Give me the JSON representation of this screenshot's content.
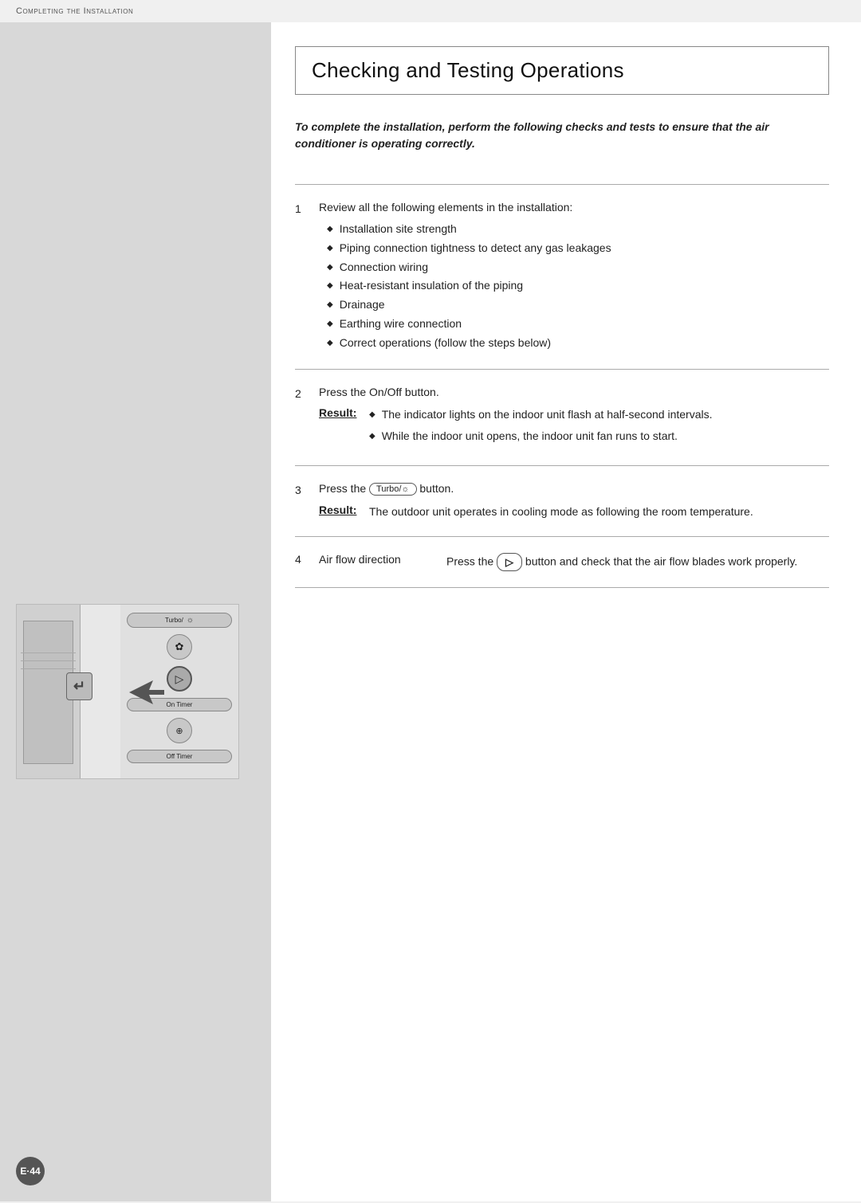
{
  "header": {
    "breadcrumb": "Completing the Installation"
  },
  "page": {
    "title": "Checking and Testing Operations",
    "intro": "To complete the installation, perform the following checks and tests to ensure that the air conditioner is operating correctly.",
    "steps": [
      {
        "number": "1",
        "title": "Review all the following elements in the installation:",
        "bullets": [
          "Installation site strength",
          "Piping connection tightness to detect any gas leakages",
          "Connection wiring",
          "Heat-resistant insulation of the piping",
          "Drainage",
          "Earthing wire connection",
          "Correct operations (follow the steps below)"
        ]
      },
      {
        "number": "2",
        "title": "Press the On/Off button.",
        "result_label": "Result:",
        "result_bullets": [
          "The indicator lights on the indoor unit flash at half-second intervals.",
          "While the indoor unit opens, the indoor unit fan runs to start."
        ]
      },
      {
        "number": "3",
        "title_prefix": "Press the",
        "title_btn": "Turbo/",
        "title_suffix": "button.",
        "result_label": "Result:",
        "result_text": "The outdoor unit operates in cooling mode as following the room temperature."
      },
      {
        "number": "4",
        "label": "Air flow direction",
        "text_prefix": "Press the",
        "btn_label": "▷",
        "text_suffix": "button and check that the air flow blades work properly."
      }
    ],
    "page_number": "E·44"
  },
  "device": {
    "vane_symbol": "↵",
    "buttons": [
      {
        "label": "Turbo/☼",
        "highlighted": false
      },
      {
        "label": "✿",
        "highlighted": false,
        "round": true
      },
      {
        "label": "▷",
        "highlighted": true,
        "round": true
      },
      {
        "label": "On Timer",
        "highlighted": false
      },
      {
        "label": "⊕",
        "highlighted": false,
        "round": true
      },
      {
        "label": "Off Timer",
        "highlighted": false
      }
    ]
  }
}
